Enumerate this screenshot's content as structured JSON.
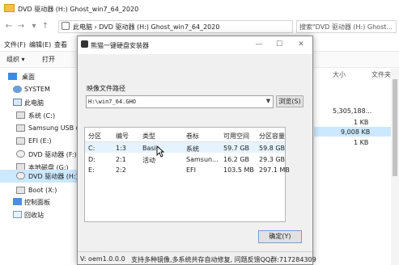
{
  "explorer": {
    "title": "DVD 驱动器 (H:) Ghost_win7_64_2020",
    "address": "此电脑  ›  DVD 驱动器 (H:) Ghost_win7_64_2020",
    "search_placeholder": "搜索\"DVD 驱动器 (H:) Ghost...",
    "menu": [
      "文件(F)",
      "编辑(E)",
      "查看"
    ],
    "toolbar": {
      "organize": "组织 ▾",
      "open": "打开"
    },
    "sidebar": [
      {
        "label": "桌面",
        "icon": "desktop-icon"
      },
      {
        "label": "SYSTEM",
        "icon": "user-folder-icon"
      },
      {
        "label": "此电脑",
        "icon": "computer-icon"
      },
      {
        "label": "系统 (C:)",
        "icon": "drive-icon"
      },
      {
        "label": "Samsung USB (I",
        "icon": "drive-icon"
      },
      {
        "label": "EFI (E:)",
        "icon": "drive-icon"
      },
      {
        "label": "DVD 驱动器 (F:)",
        "icon": "dvd-icon"
      },
      {
        "label": "本地磁盘 (G:)",
        "icon": "drive-icon"
      },
      {
        "label": "DVD 驱动器 (H:)",
        "icon": "dvd-icon"
      },
      {
        "label": "Boot (X:)",
        "icon": "drive-icon"
      },
      {
        "label": "控制面板",
        "icon": "control-panel-icon"
      },
      {
        "label": "回收站",
        "icon": "recycle-bin-icon"
      }
    ],
    "columns": {
      "size": "大小",
      "type": "文件夹"
    },
    "sizes": [
      "5,305,188...",
      "1 KB",
      "9,008 KB",
      "1 KB"
    ]
  },
  "dialog": {
    "title": "熊猫一键硬盘安装器",
    "path_label": "映像文件路径",
    "path_value": "H:\\win7_64.GHO",
    "browse_label": "浏览(S)",
    "table_headers": [
      "分区",
      "编号",
      "类型",
      "卷标",
      "可用空间",
      "分区容量"
    ],
    "rows": [
      [
        "C:",
        "1:3",
        "Basic",
        "系统",
        "59.7 GB",
        "59.8 GB"
      ],
      [
        "D:",
        "2:1",
        "活动",
        "Samsun...",
        "16.2 GB",
        "29.3 GB"
      ],
      [
        "E:",
        "2:2",
        "",
        "EFI",
        "103.5 MB",
        "297.1 MB"
      ]
    ],
    "ok_label": "确定(Y)",
    "version": "V:  oem1.0.0.0",
    "status_text": "支持多种镜像,多系统共存自动修复, 问题反馈QQ群:717284309"
  }
}
